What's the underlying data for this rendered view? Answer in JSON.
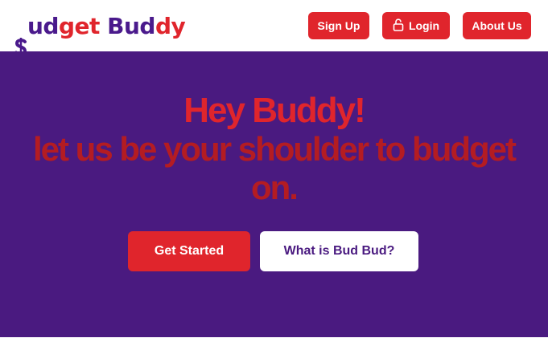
{
  "brand": {
    "logo_part1": "udget ",
    "logo_part2": "Bud",
    "logo_part3": "dy",
    "logo_prefix": "get",
    "colors": {
      "purple": "#4a1a80",
      "red": "#e0252c",
      "dark_red": "#b41c22"
    }
  },
  "nav": {
    "signup_label": "Sign Up",
    "login_label": "Login",
    "login_icon": "lock-icon",
    "about_label": "About Us"
  },
  "hero": {
    "line1": "Hey Buddy!",
    "line2": "let us be your shoulder to budget on.",
    "primary_cta": "Get Started",
    "secondary_cta": "What is Bud Bud?"
  }
}
